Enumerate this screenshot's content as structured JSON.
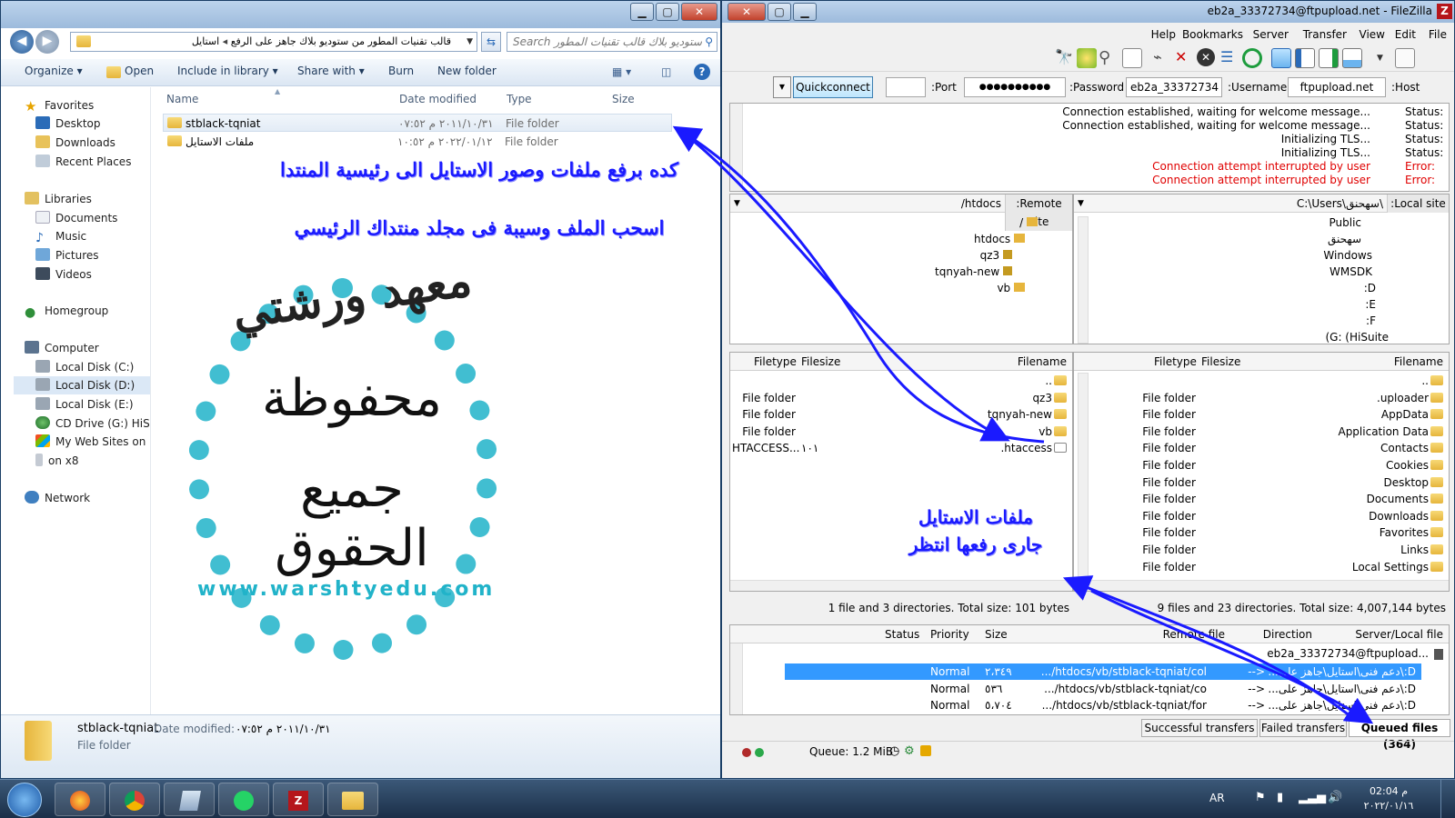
{
  "explorer": {
    "breadcrumb": [
      "قالب تقنيات المطور من ستوديو بلاك جاهز على الرفع",
      "استايل"
    ],
    "search_placeholder": "Search ستوديو بلاك قالب تقنيات المطور من",
    "toolbar": [
      "Organize ▾",
      "Open",
      "Include in library ▾",
      "Share with ▾",
      "Burn",
      "New folder"
    ],
    "columns": [
      "Name",
      "Date modified",
      "Type",
      "Size"
    ],
    "nav": {
      "favorites": "Favorites",
      "favorites_items": [
        "Desktop",
        "Downloads",
        "Recent Places"
      ],
      "libraries": "Libraries",
      "libraries_items": [
        "Documents",
        "Music",
        "Pictures",
        "Videos"
      ],
      "homegroup": "Homegroup",
      "computer": "Computer",
      "computer_items": [
        "Local Disk (C:)",
        "Local Disk (D:)",
        "Local Disk (E:)",
        "CD Drive (G:) HiSuite",
        "My Web Sites on MSN",
        "on x8"
      ],
      "network": "Network"
    },
    "files": [
      {
        "name": "stblack-tqniat",
        "date": "٢٠١١/١٠/٣١ م ٠٧:٥٢",
        "type": "File folder",
        "size": ""
      },
      {
        "name": "ملفات الاستايل",
        "date": "٢٠٢٢/٠١/١٢ م ١٠:٥٢",
        "type": "File folder",
        "size": ""
      }
    ],
    "details": {
      "name": "stblack-tqniat",
      "date_label": "Date modified:",
      "date": "٢٠١١/١٠/٣١ م ٠٧:٥٢",
      "type": "File folder"
    },
    "annotation_1": "كده برفع ملفات وصور الاستايل الى رئيسية المنتدا",
    "annotation_2": "اسحب الملف وسيبة فى مجلد منتداك الرئيسي",
    "watermark_top": "معهد ورشتي",
    "watermark_mid": "محفوظة",
    "watermark_bot": "جميع الحقوق",
    "watermark_ring": "www.warshtyedu.com"
  },
  "filezilla": {
    "title": "eb2a_33372734@ftpupload.net - FileZilla",
    "menu": [
      "File",
      "Edit",
      "View",
      "Transfer",
      "Server",
      "Bookmarks",
      "Help"
    ],
    "quickconnect": {
      "host_label": ":Host",
      "host": "ftpupload.net",
      "user_label": ":Username",
      "user": "eb2a_33372734",
      "pass_label": ":Password",
      "pass": "●●●●●●●●●●",
      "port_label": ":Port",
      "port": "",
      "button": "Quickconnect"
    },
    "log": [
      {
        "type": "Status:",
        "msg": "Connection established, waiting for welcome message...",
        "error": false
      },
      {
        "type": "Status:",
        "msg": "Connection established, waiting for welcome message...",
        "error": false
      },
      {
        "type": "Status:",
        "msg": "Initializing TLS...",
        "error": false
      },
      {
        "type": "Status:",
        "msg": "Initializing TLS...",
        "error": false
      },
      {
        "type": "Error:",
        "msg": "Connection attempt interrupted by user",
        "error": true
      },
      {
        "type": "Error:",
        "msg": "Connection attempt interrupted by user",
        "error": true
      }
    ],
    "local": {
      "site_label": ":Local site",
      "site_path": "C:\\Users\\سهحنق\\",
      "tree": [
        "Public",
        "سهحنق",
        "Windows",
        "WMSDK",
        ":D",
        ":E",
        ":F",
        "(G: (HiSuite"
      ],
      "headers": [
        "Filename",
        "Filesize",
        "Filetype"
      ],
      "files": [
        {
          "name": "..",
          "type": ""
        },
        {
          "name": ".uploader",
          "type": "File folder"
        },
        {
          "name": "AppData",
          "type": "File folder"
        },
        {
          "name": "Application Data",
          "type": "File folder"
        },
        {
          "name": "Contacts",
          "type": "File folder"
        },
        {
          "name": "Cookies",
          "type": "File folder"
        },
        {
          "name": "Desktop",
          "type": "File folder"
        },
        {
          "name": "Documents",
          "type": "File folder"
        },
        {
          "name": "Downloads",
          "type": "File folder"
        },
        {
          "name": "Favorites",
          "type": "File folder"
        },
        {
          "name": "Links",
          "type": "File folder"
        },
        {
          "name": "Local Settings",
          "type": "File folder"
        }
      ],
      "status": "9 files and 23 directories. Total size: 4,007,144 bytes"
    },
    "remote": {
      "site_label": ":Remote site",
      "site_path": "/htdocs",
      "tree": [
        "/",
        "htdocs",
        "qz3",
        "tqnyah-new",
        "vb"
      ],
      "headers": [
        "Filename",
        "Filesize",
        "Filetype"
      ],
      "files": [
        {
          "name": "..",
          "size": "",
          "type": ""
        },
        {
          "name": "qz3",
          "size": "",
          "type": "File folder"
        },
        {
          "name": "tqnyah-new",
          "size": "",
          "type": "File folder"
        },
        {
          "name": "vb",
          "size": "",
          "type": "File folder"
        },
        {
          "name": ".htaccess",
          "size": "١٠١",
          "type": "HTACCESS..."
        }
      ],
      "status": "1 file and 3 directories. Total size: 101 bytes",
      "annotation_1": "ملفات الاستايل",
      "annotation_2": "جارى رفعها انتظر"
    },
    "queue": {
      "headers": [
        "Server/Local file",
        "Direction",
        "Remote file",
        "Size",
        "Priority",
        "Status"
      ],
      "server": "eb2a_33372734@ftpupload...",
      "rows": [
        {
          "local": "D:\\دعم فنى\\استايل\\جاهز على...",
          "dir": "-->",
          "remote": "htdocs/vb/stblack-tqniat/col/...",
          "size": "٢،٣٤٩",
          "priority": "Normal"
        },
        {
          "local": "D:\\دعم فنى\\استايل\\جاهز على...",
          "dir": "-->",
          "remote": "htdocs/vb/stblack-tqniat/co/...",
          "size": "٥٣٦",
          "priority": "Normal"
        },
        {
          "local": "D:\\دعم فنى\\استايل\\جاهز على...",
          "dir": "-->",
          "remote": "htdocs/vb/stblack-tqniat/for/...",
          "size": "٥،٧٠٤",
          "priority": "Normal"
        }
      ],
      "tabs": [
        "Queued files (364)",
        "Failed transfers",
        "Successful transfers"
      ],
      "queue_size": "Queue: 1.2 MiB"
    }
  },
  "taskbar": {
    "lang": "AR",
    "time": "02:04 م",
    "date": "٢٠٢٢/٠١/١٦"
  }
}
